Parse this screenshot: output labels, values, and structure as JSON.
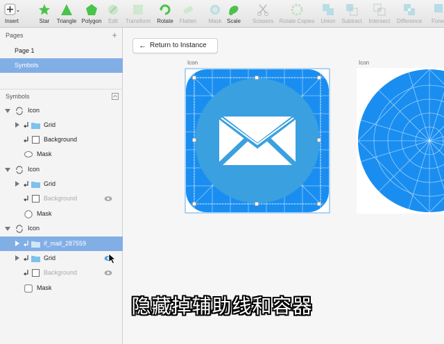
{
  "toolbar": {
    "insert": "Insert",
    "star": "Star",
    "triangle": "Triangle",
    "polygon": "Polygon",
    "edit": "Edit",
    "transform": "Transform",
    "rotate": "Rotate",
    "flatten": "Flatten",
    "mask": "Mask",
    "scale": "Scale",
    "scissors": "Scissors",
    "rotate_copies": "Rotate Copies",
    "union": "Union",
    "subtract": "Subtract",
    "intersect": "Intersect",
    "difference": "Difference",
    "forward": "Forw"
  },
  "pages": {
    "header": "Pages",
    "add": "+",
    "items": [
      "Page 1",
      "Symbols"
    ]
  },
  "symbols": {
    "header": "Symbols",
    "groups": [
      {
        "name": "Icon",
        "children": [
          "Grid",
          "Background",
          "Mask"
        ]
      },
      {
        "name": "Icon",
        "children": [
          "Grid",
          "Background",
          "Mask"
        ]
      },
      {
        "name": "Icon",
        "children": [
          "if_mail_287559",
          "Grid",
          "Background",
          "Mask"
        ]
      }
    ]
  },
  "canvas": {
    "return_button": "Return to Instance",
    "artboard1_label": "Icon",
    "artboard2_label": "Icon"
  },
  "subtitle": "隐藏掉辅助线和容器",
  "colors": {
    "selection": "#82aee6",
    "icon_blue": "#1a8ef0",
    "circle_blue": "#3aa0e0",
    "accent": "#4a9fe8"
  }
}
